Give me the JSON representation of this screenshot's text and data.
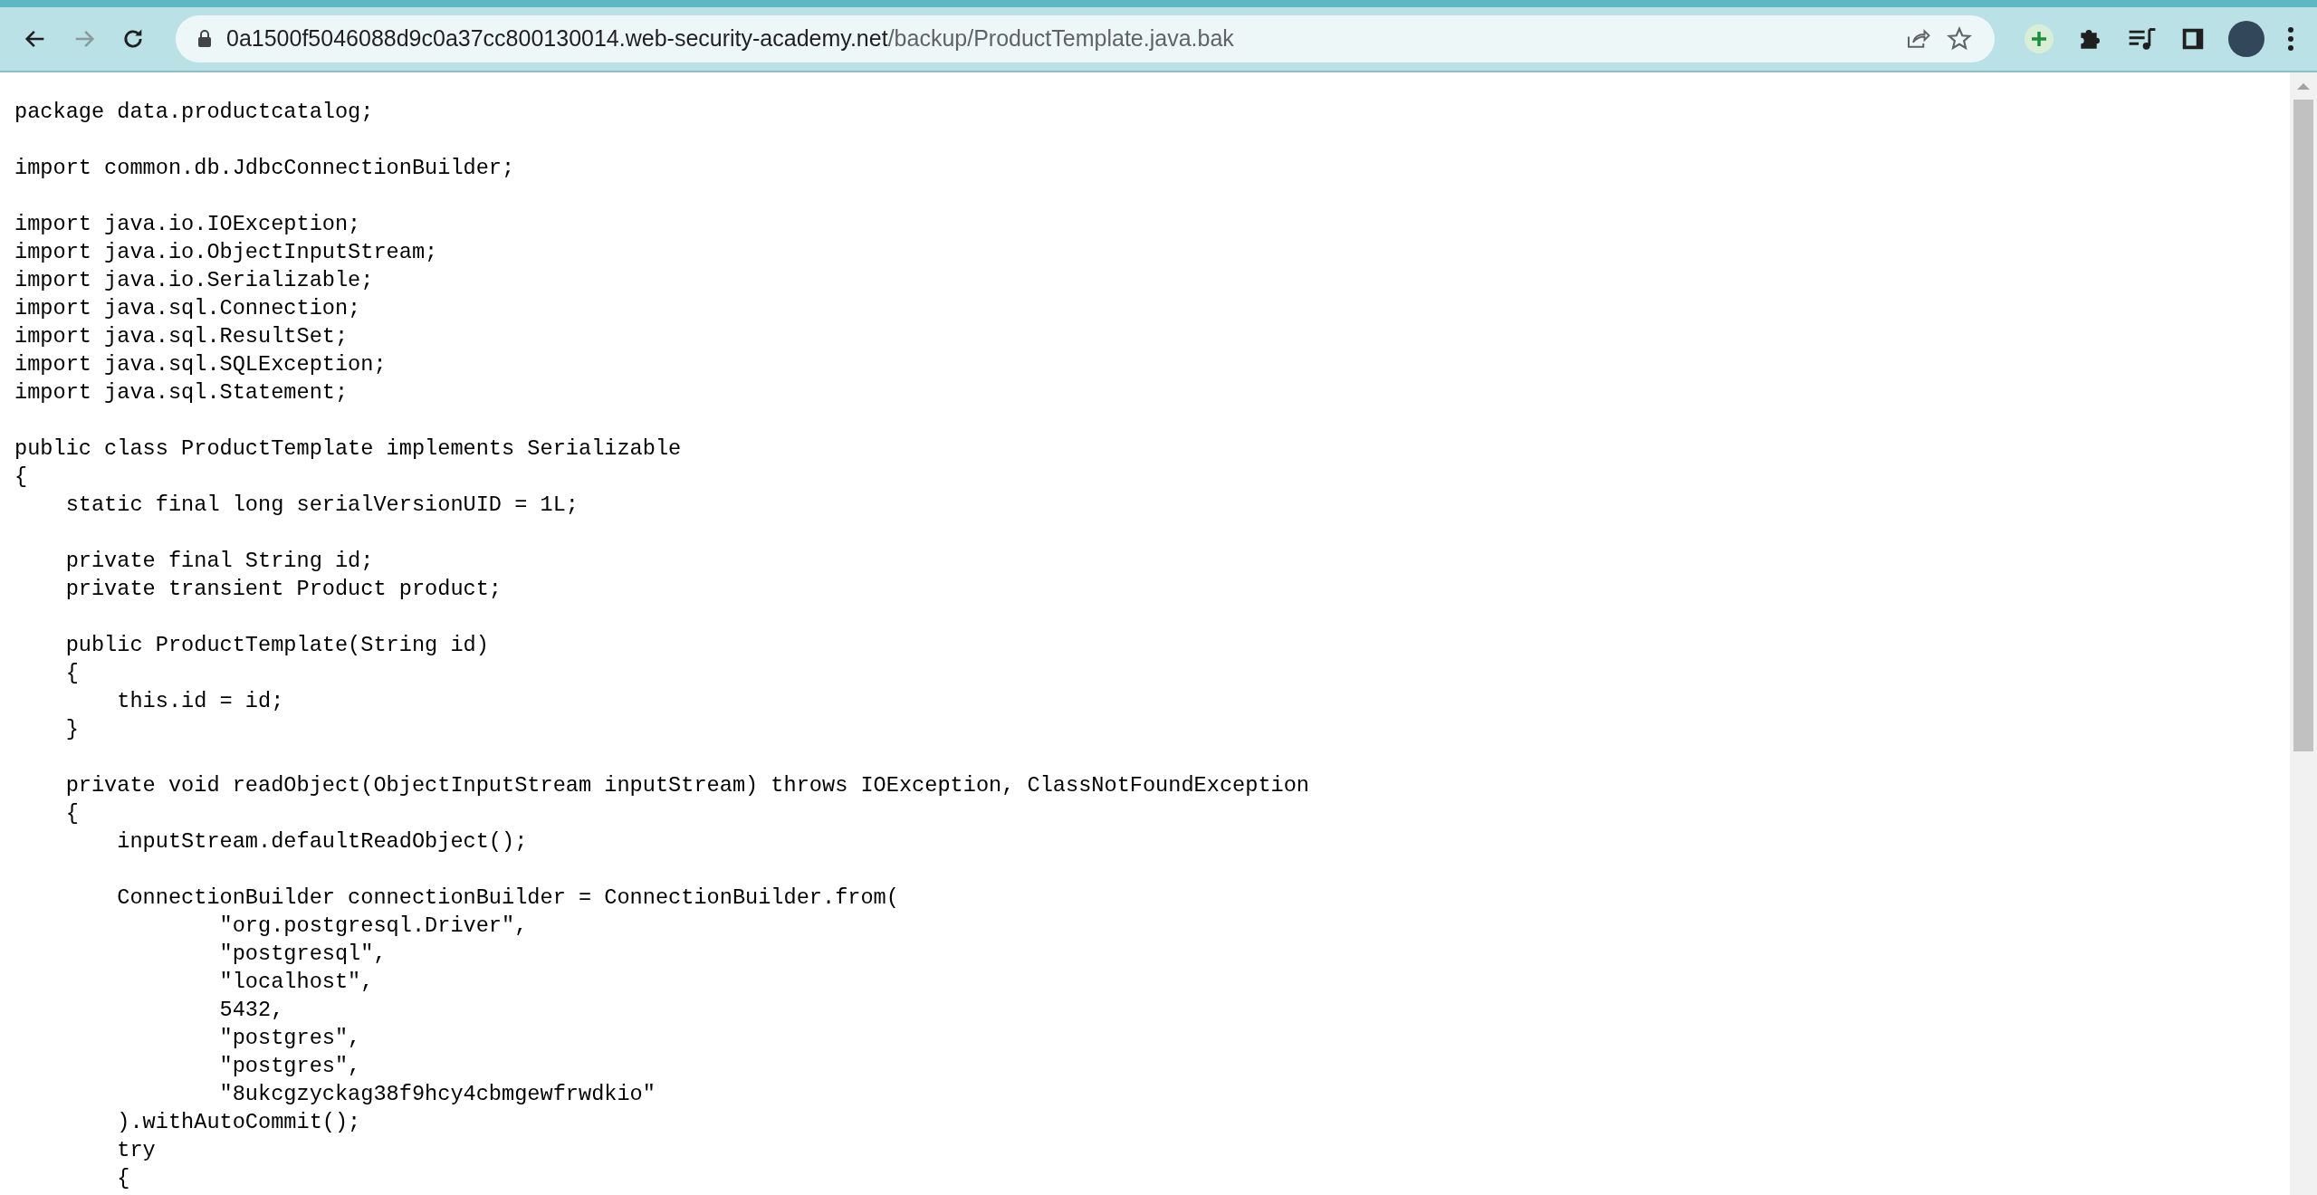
{
  "browser": {
    "back": {
      "disabled": false
    },
    "forward": {
      "disabled": true
    },
    "url_host": "0a1500f5046088d9c0a37cc800130014.web-security-academy.net",
    "url_path": "/backup/ProductTemplate.java.bak"
  },
  "code_blocks": [
    [
      "package data.productcatalog;"
    ],
    [
      "import common.db.JdbcConnectionBuilder;"
    ],
    [
      "import java.io.IOException;",
      "import java.io.ObjectInputStream;",
      "import java.io.Serializable;",
      "import java.sql.Connection;",
      "import java.sql.ResultSet;",
      "import java.sql.SQLException;",
      "import java.sql.Statement;"
    ],
    [
      "public class ProductTemplate implements Serializable",
      "{",
      "    static final long serialVersionUID = 1L;"
    ],
    [
      "    private final String id;",
      "    private transient Product product;"
    ],
    [
      "    public ProductTemplate(String id)",
      "    {",
      "        this.id = id;",
      "    }"
    ],
    [
      "    private void readObject(ObjectInputStream inputStream) throws IOException, ClassNotFoundException",
      "    {",
      "        inputStream.defaultReadObject();"
    ],
    [
      "        ConnectionBuilder connectionBuilder = ConnectionBuilder.from(",
      "                \"org.postgresql.Driver\",",
      "                \"postgresql\",",
      "                \"localhost\",",
      "                5432,",
      "                \"postgres\",",
      "                \"postgres\",",
      "                \"8ukcgzyckag38f9hcy4cbmgewfrwdkio\"",
      "        ).withAutoCommit();",
      "        try",
      "        {"
    ]
  ]
}
